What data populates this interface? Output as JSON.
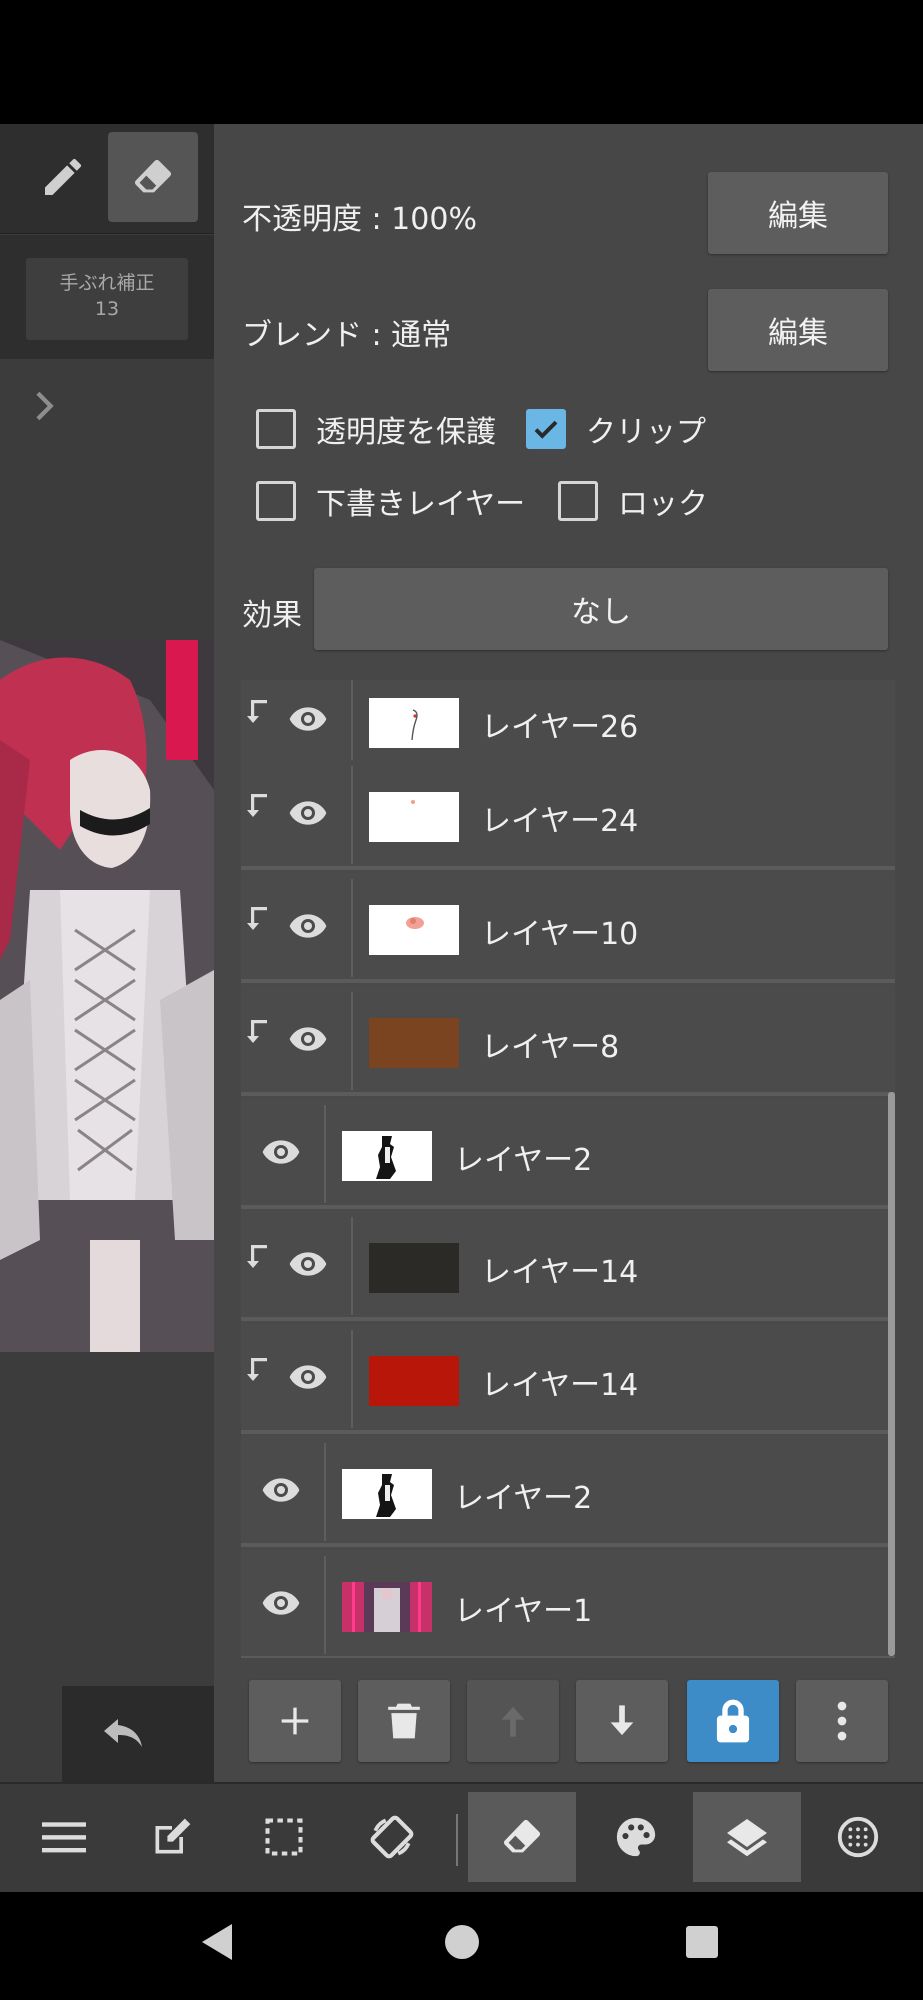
{
  "canvas": {
    "stabilizer_label": "手ぶれ補正",
    "stabilizer_value": "13"
  },
  "properties": {
    "opacity_label": "不透明度 : 100%",
    "blend_label": "ブレンド : 通常",
    "edit_label": "編集",
    "protect_alpha_label": "透明度を保護",
    "protect_alpha_checked": false,
    "clip_label": "クリップ",
    "clip_checked": true,
    "draft_layer_label": "下書きレイヤー",
    "draft_layer_checked": false,
    "lock_label": "ロック",
    "lock_checked": false,
    "effect_label": "効果",
    "effect_value": "なし"
  },
  "layers": [
    {
      "name": "レイヤー26",
      "clipped": true,
      "thumb": "sketch"
    },
    {
      "name": "レイヤー24",
      "clipped": true,
      "thumb": "blank"
    },
    {
      "name": "レイヤー10",
      "clipped": true,
      "thumb": "pink-dot"
    },
    {
      "name": "レイヤー8",
      "clipped": true,
      "thumb": "#7b4420"
    },
    {
      "name": "レイヤー2",
      "clipped": false,
      "thumb": "figure"
    },
    {
      "name": "レイヤー14",
      "clipped": true,
      "thumb": "#2c2a27"
    },
    {
      "name": "レイヤー14",
      "clipped": true,
      "thumb": "#b81608"
    },
    {
      "name": "レイヤー2",
      "clipped": false,
      "thumb": "figure"
    },
    {
      "name": "レイヤー1",
      "clipped": false,
      "thumb": "artwork"
    }
  ],
  "layer_buttons": [
    "add-icon",
    "trash-icon",
    "move-up-icon",
    "move-down-icon",
    "lock-icon",
    "more-icon"
  ],
  "bottom_toolbar": [
    "menu-icon",
    "edit-icon",
    "selection-icon",
    "transform-icon",
    "eraser-icon",
    "palette-icon",
    "layers-icon",
    "globe-icon"
  ],
  "colors": {
    "accent": "#3d8bc7",
    "check": "#6ab7e6",
    "panel": "#474747"
  }
}
